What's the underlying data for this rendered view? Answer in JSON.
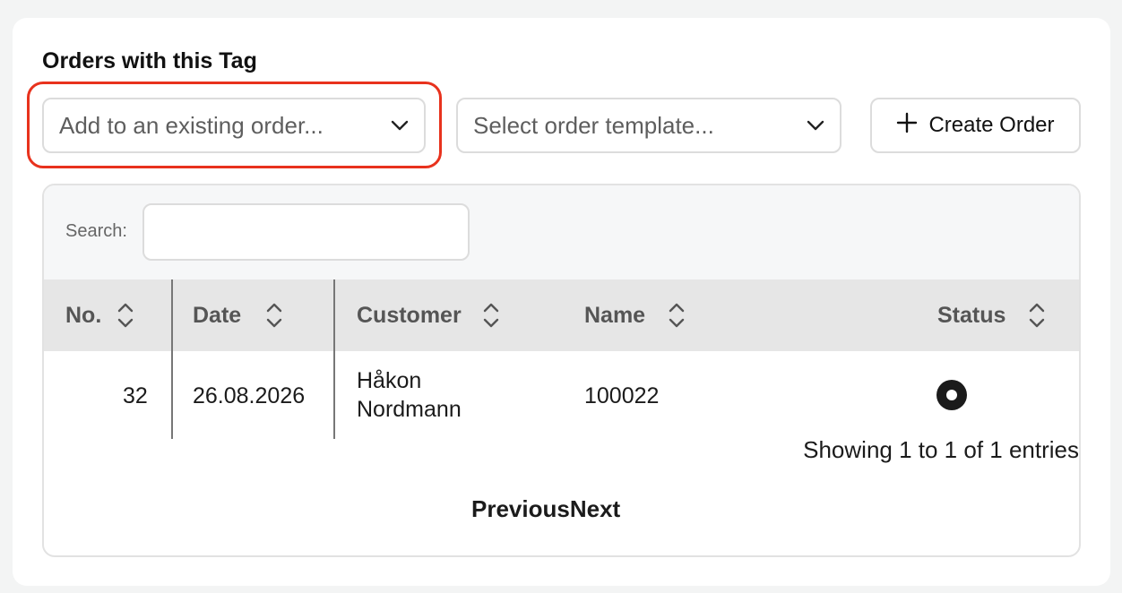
{
  "section": {
    "title": "Orders with this Tag"
  },
  "controls": {
    "existing_order_placeholder": "Add to an existing order...",
    "template_placeholder": "Select order template...",
    "create_label": "Create Order"
  },
  "search": {
    "label": "Search:",
    "value": ""
  },
  "table": {
    "columns": [
      "No.",
      "Date",
      "Customer",
      "Name",
      "Status"
    ],
    "rows": [
      {
        "no": "32",
        "date": "26.08.2026",
        "customer_line1": "Håkon",
        "customer_line2": "Nordmann",
        "name": "100022",
        "status_icon": "status-dot-icon"
      }
    ],
    "info": "Showing 1 to 1 of 1 entries",
    "prev_label": "Previous",
    "next_label": "Next"
  },
  "colors": {
    "highlight": "#e8321d",
    "header_bg": "#e6e6e6"
  }
}
